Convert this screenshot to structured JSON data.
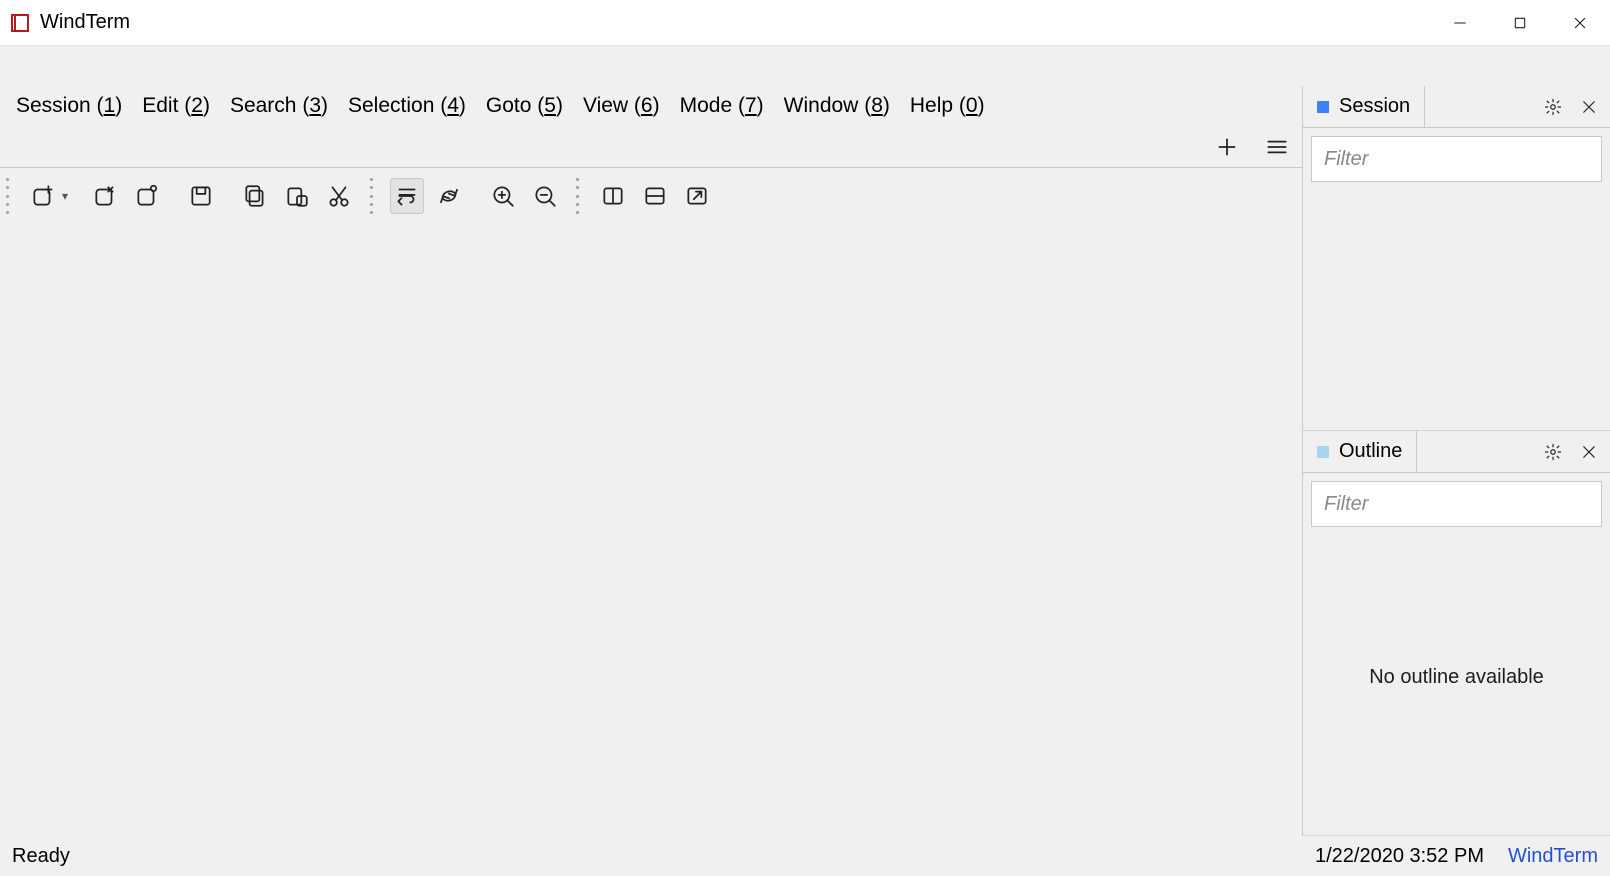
{
  "app": {
    "title": "WindTerm"
  },
  "menubar": [
    {
      "label": "Session",
      "accel": "1"
    },
    {
      "label": "Edit",
      "accel": "2"
    },
    {
      "label": "Search",
      "accel": "3"
    },
    {
      "label": "Selection",
      "accel": "4"
    },
    {
      "label": "Goto",
      "accel": "5"
    },
    {
      "label": "View",
      "accel": "6"
    },
    {
      "label": "Mode",
      "accel": "7"
    },
    {
      "label": "Window",
      "accel": "8"
    },
    {
      "label": "Help",
      "accel": "0"
    }
  ],
  "sidebar": {
    "session": {
      "tab_label": "Session",
      "filter_placeholder": "Filter"
    },
    "outline": {
      "tab_label": "Outline",
      "filter_placeholder": "Filter",
      "empty_text": "No outline available"
    }
  },
  "statusbar": {
    "status": "Ready",
    "datetime": "1/22/2020 3:52 PM",
    "brand": "WindTerm"
  }
}
